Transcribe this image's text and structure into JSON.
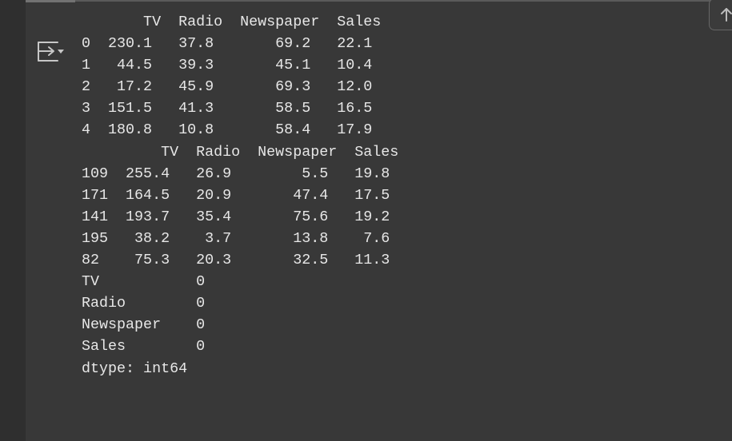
{
  "output": {
    "lines": [
      "       TV  Radio  Newspaper  Sales",
      "0  230.1   37.8       69.2   22.1",
      "1   44.5   39.3       45.1   10.4",
      "2   17.2   45.9       69.3   12.0",
      "3  151.5   41.3       58.5   16.5",
      "4  180.8   10.8       58.4   17.9",
      "         TV  Radio  Newspaper  Sales",
      "109  255.4   26.9        5.5   19.8",
      "171  164.5   20.9       47.4   17.5",
      "141  193.7   35.4       75.6   19.2",
      "195   38.2    3.7       13.8    7.6",
      "82    75.3   20.3       32.5   11.3",
      "TV           0",
      "Radio        0",
      "Newspaper    0",
      "Sales        0",
      "dtype: int64"
    ],
    "text": "       TV  Radio  Newspaper  Sales\n0  230.1   37.8       69.2   22.1\n1   44.5   39.3       45.1   10.4\n2   17.2   45.9       69.3   12.0\n3  151.5   41.3       58.5   16.5\n4  180.8   10.8       58.4   17.9\n         TV  Radio  Newspaper  Sales\n109  255.4   26.9        5.5   19.8\n171  164.5   20.9       47.4   17.5\n141  193.7   35.4       75.6   19.2\n195   38.2    3.7       13.8    7.6\n82    75.3   20.3       32.5   11.3\nTV           0\nRadio        0\nNewspaper    0\nSales        0\ndtype: int64"
  },
  "icons": {
    "output_toggle": "output-toggle-icon",
    "scroll_up": "arrow-up-icon"
  },
  "colors": {
    "background": "#383838",
    "text": "#e7e7e7"
  }
}
